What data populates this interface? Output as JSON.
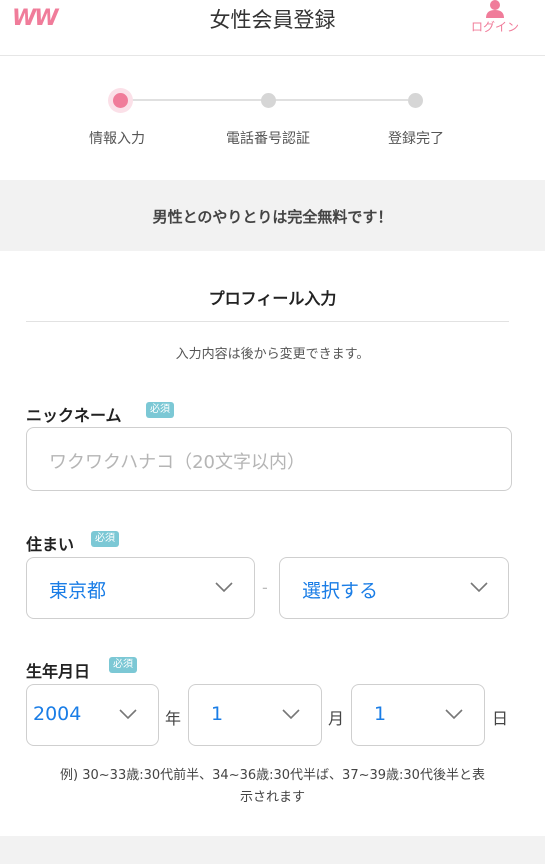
{
  "header": {
    "logo": "WW",
    "title": "女性会員登録",
    "login_label": "ログイン"
  },
  "steps": [
    {
      "label": "情報入力",
      "active": true
    },
    {
      "label": "電話番号認証",
      "active": false
    },
    {
      "label": "登録完了",
      "active": false
    }
  ],
  "banner": "男性とのやりとりは完全無料です！",
  "profile": {
    "title": "プロフィール入力",
    "note": "入力内容は後から変更できます。"
  },
  "required_badge": "必須",
  "nickname": {
    "label": "ニックネーム",
    "placeholder": "ワクワクハナコ（20文字以内）"
  },
  "residence": {
    "label": "住まい",
    "prefecture": "東京都",
    "separator": "-",
    "city": "選択する"
  },
  "birthdate": {
    "label": "生年月日",
    "year": "2004",
    "year_unit": "年",
    "month": "1",
    "month_unit": "月",
    "day": "1",
    "day_unit": "日"
  },
  "example_line1": "例) 30~33歳:30代前半、34~36歳:30代半ば、37~39歳:30代後半と表",
  "example_line2": "示されます",
  "colors": {
    "accent": "#f07c9a",
    "select_value": "#1a7de6",
    "badge": "#7cc8d5"
  }
}
